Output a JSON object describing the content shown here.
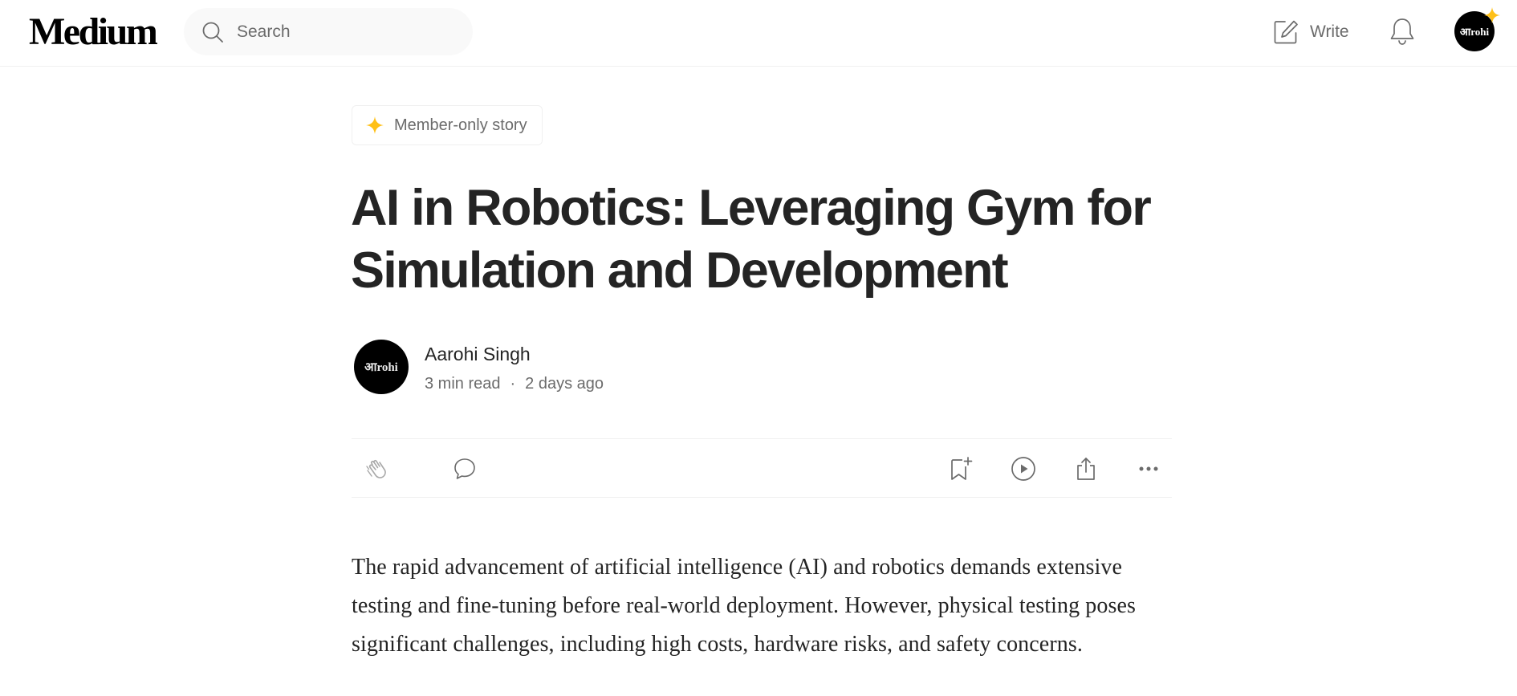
{
  "header": {
    "logo": "Medium",
    "search_placeholder": "Search",
    "write_label": "Write",
    "avatar_text": "आrohi"
  },
  "article": {
    "badge_label": "Member-only story",
    "title": "AI in Robotics: Leveraging Gym for Simulation and Development",
    "author": {
      "name": "Aarohi Singh",
      "avatar_text": "आrohi"
    },
    "read_time": "3 min read",
    "separator": "·",
    "published": "2 days ago",
    "body": "The rapid advancement of artificial intelligence (AI) and robotics demands extensive testing and fine-tuning before real-world deployment. However, physical testing poses significant challenges, including high costs, hardware risks, and safety concerns."
  },
  "colors": {
    "text": "#242424",
    "muted": "#6b6b6b",
    "member_star": "#ffc017",
    "divider": "#f0f0f0"
  },
  "icons": {
    "search": "search-icon",
    "write": "write-icon",
    "notifications": "bell-icon",
    "member": "sparkle-icon",
    "clap": "clap-icon",
    "response": "comment-icon",
    "save": "bookmark-add-icon",
    "listen": "play-icon",
    "share": "share-icon",
    "more": "more-icon"
  }
}
